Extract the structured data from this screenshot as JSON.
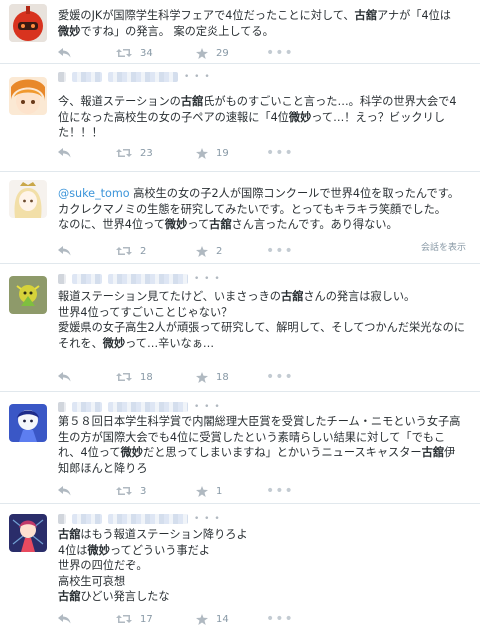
{
  "tweets": [
    {
      "avatar_icon": "red-robot-avatar-icon",
      "segments": [
        {
          "text": "愛媛のJKが国際学生科学フェアで4位だったことに対して、"
        },
        {
          "text": "古舘",
          "bold": true
        },
        {
          "text": "アナが「4位は\n"
        },
        {
          "text": "微妙",
          "bold": true
        },
        {
          "text": "ですね」の発言。 案の定炎上してる。"
        }
      ],
      "retweets": "34",
      "favorites": "29"
    },
    {
      "avatar_icon": "orange-hair-character-avatar-icon",
      "segments": [
        {
          "text": "今、報道ステーションの"
        },
        {
          "text": "古舘",
          "bold": true
        },
        {
          "text": "氏がものすごいこと言った…。科学の世界大会で4\n位になった高校生の女の子ペアの速報に「4位"
        },
        {
          "text": "微妙",
          "bold": true
        },
        {
          "text": "って…！えっ？ビックリし\nた！！！"
        }
      ],
      "retweets": "23",
      "favorites": "19"
    },
    {
      "avatar_icon": "crowned-girl-avatar-icon",
      "segments": [
        {
          "text": "@suke_tomo",
          "mention": true
        },
        {
          "text": " 高校生の女の子2人が国際コンクールで世界4位を取ったんです。\nカクレクマノミの生態を研究してみたいです。とってもキラキラ笑顔でした。\nなのに、世界4位って"
        },
        {
          "text": "微妙",
          "bold": true
        },
        {
          "text": "って"
        },
        {
          "text": "古舘",
          "bold": true
        },
        {
          "text": "さん言ったんです。あり得ない。"
        }
      ],
      "retweets": "2",
      "favorites": "2",
      "conversation_label": "会話を表示"
    },
    {
      "avatar_icon": "green-creature-avatar-icon",
      "segments": [
        {
          "text": "報道ステーション見てたけど、いまさっきの"
        },
        {
          "text": "古舘",
          "bold": true
        },
        {
          "text": "さんの発言は寂しい。\n世界4位ってすごいことじゃない？\n愛媛県の女子高生2人が頑張って研究して、解明して、そしてつかんだ栄光なのに\nそれを、"
        },
        {
          "text": "微妙",
          "bold": true
        },
        {
          "text": "って…辛いなぁ…"
        }
      ],
      "retweets": "18",
      "favorites": "18"
    },
    {
      "avatar_icon": "blue-character-avatar-icon",
      "segments": [
        {
          "text": "第５８回日本学生科学賞で内閣総理大臣賞を受賞したチーム・ニモという女子高\n生の方が国際大会でも4位に受賞したという素晴らしい結果に対して「でもこ\nれ、4位って"
        },
        {
          "text": "微妙",
          "bold": true
        },
        {
          "text": "だと思ってしまいますね」とかいうニュースキャスター"
        },
        {
          "text": "古舘",
          "bold": true
        },
        {
          "text": "伊\n知郎ほんと降りろ"
        }
      ],
      "retweets": "3",
      "favorites": "1"
    },
    {
      "avatar_icon": "anime-character-avatar-icon",
      "segments": [
        {
          "text": "古舘",
          "bold": true
        },
        {
          "text": "はもう報道ステーション降りろよ\n4位は"
        },
        {
          "text": "微妙",
          "bold": true
        },
        {
          "text": "ってどういう事だよ\n世界の四位だぞ。\n高校生可哀想\n"
        },
        {
          "text": "古舘",
          "bold": true
        },
        {
          "text": "ひどい発言したな"
        }
      ],
      "retweets": "17",
      "favorites": "14"
    }
  ],
  "icons": {
    "reply": "reply-icon",
    "retweet": "retweet-icon",
    "favorite": "star-icon",
    "more": "more-dots-icon"
  },
  "colors": {
    "mention": "#3b94d9",
    "icon_gray": "#9aa4ad",
    "border": "#e1e8ed"
  }
}
